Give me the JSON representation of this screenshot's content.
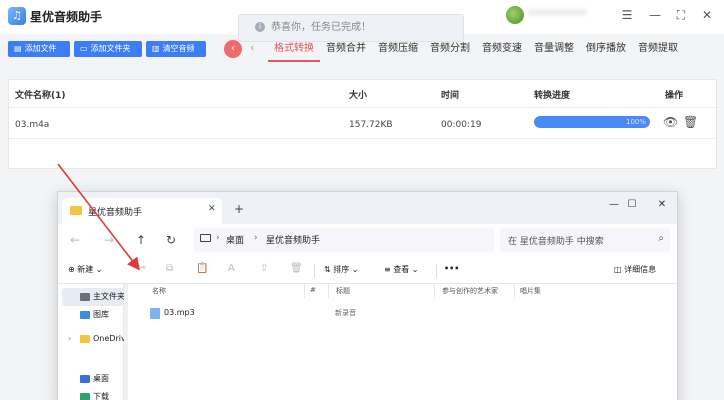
{
  "app": {
    "logo_glyph": "♫",
    "title": "星优音频助手",
    "toast": {
      "icon": "i",
      "message": "恭喜你，任务已完成！"
    },
    "window_controls": {
      "menu": "☰",
      "minimize": "—",
      "maximize": "⛶",
      "close": "✕"
    },
    "toolbar": {
      "add_file": "添加文件",
      "add_folder": "添加文件夹",
      "clear": "清空音频",
      "add_file_icon": "▤",
      "add_folder_icon": "▭",
      "clear_icon": "▥"
    },
    "nav": {
      "collapse": "‹",
      "prev": "‹"
    },
    "tabs": [
      {
        "label": "格式转换",
        "active": true
      },
      {
        "label": "音频合并",
        "active": false
      },
      {
        "label": "音频压缩",
        "active": false
      },
      {
        "label": "音频分割",
        "active": false
      },
      {
        "label": "音频变速",
        "active": false
      },
      {
        "label": "音量调整",
        "active": false
      },
      {
        "label": "倒序播放",
        "active": false
      },
      {
        "label": "音频提取",
        "active": false
      }
    ],
    "table": {
      "headers": {
        "name": "文件名称(1)",
        "size": "大小",
        "time": "时间",
        "progress": "转换进度",
        "action": "操作"
      },
      "rows": [
        {
          "name": "03.m4a",
          "size": "157.72KB",
          "time": "00:00:19",
          "progress_label": "100%",
          "progress": 1.0
        }
      ],
      "action_icons": {
        "view": "👁",
        "delete": "🗑"
      }
    }
  },
  "explorer": {
    "tab": {
      "label": "星优音频助手",
      "close": "✕",
      "new": "+"
    },
    "window_controls": {
      "minimize": "—",
      "maximize": "☐",
      "close": "✕"
    },
    "nav": {
      "back": "←",
      "forward": "→",
      "up": "↑",
      "refresh": "↻"
    },
    "path": {
      "chevron": "›",
      "segments": [
        "桌面",
        "星优音频助手"
      ],
      "sep": "›"
    },
    "search": {
      "placeholder": "在 星优音频助手 中搜索",
      "icon": "⌕"
    },
    "commands": {
      "new": "新建",
      "new_icon": "⊕",
      "sort": "排序",
      "sort_icon": "⇅",
      "view": "查看",
      "view_icon": "≡",
      "more": "•••",
      "details": "详细信息",
      "details_icon": "◫",
      "cut_icon": "✂",
      "copy_icon": "⧉",
      "paste_icon": "📋",
      "rename_icon": "A",
      "share_icon": "⇪",
      "delete_icon": "🗑",
      "dropdown": "⌄"
    },
    "nav_pane": [
      {
        "label": "主文件夹",
        "selected": true,
        "color": "#6b6f77"
      },
      {
        "label": "图库",
        "selected": false,
        "color": "#3b8ed9"
      },
      {
        "label": "OneDrive",
        "selected": false,
        "color": "#f5c541",
        "expandable": true
      },
      {
        "label": "桌面",
        "selected": false,
        "color": "#3b6fd9"
      },
      {
        "label": "下载",
        "selected": false,
        "color": "#2ca36b"
      }
    ],
    "columns": {
      "name": "名称",
      "number": "#",
      "title": "标题",
      "artist": "参与创作的艺术家",
      "album": "唱片集"
    },
    "files": [
      {
        "name": "03.mp3",
        "title": "新录音"
      }
    ]
  }
}
